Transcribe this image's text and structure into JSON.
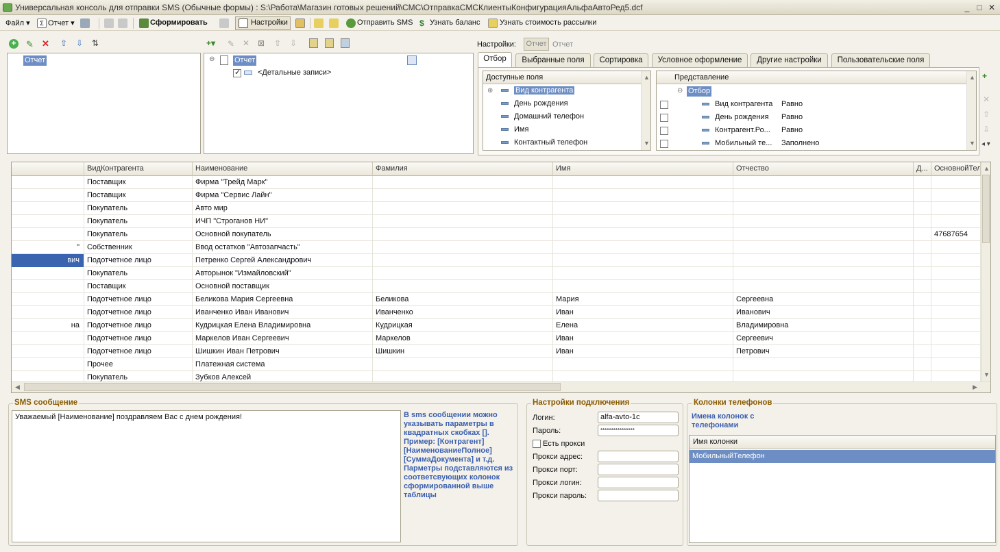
{
  "window": {
    "title": "Универсальная консоль для отправки SMS (Обычные формы) : S:\\Работа\\Магазин готовых решений\\СМС\\ОтправкаСМСКлиентыКонфигурацияАльфаАвтоРед5.dcf",
    "minimize": "_",
    "maximize": "□",
    "close": "✕"
  },
  "menu": {
    "file": "Файл ▾",
    "report": "Отчет ▾",
    "generate": "Сформировать",
    "settings": "Настройки",
    "send_sms": "Отправить SMS",
    "balance": "Узнать баланс",
    "cost": "Узнать стоимость рассылки"
  },
  "settings_label": "Настройки:",
  "settings_btn_left": "Отчет",
  "settings_btn_right": "Отчет",
  "left_tree": {
    "item": "Отчет"
  },
  "struct_tree": {
    "root": "Отчет",
    "child": "<Детальные записи>"
  },
  "tabs": [
    "Отбор",
    "Выбранные поля",
    "Сортировка",
    "Условное оформление",
    "Другие настройки",
    "Пользовательские поля"
  ],
  "available_fields": {
    "header": "Доступные поля",
    "items": [
      "Вид контрагента",
      "День рождения",
      "Домашний телефон",
      "Имя",
      "Контактный телефон"
    ]
  },
  "filter": {
    "header": "Представление",
    "root": "Отбор",
    "rows": [
      {
        "field": "Вид контрагента",
        "cond": "Равно"
      },
      {
        "field": "День рождения",
        "cond": "Равно"
      },
      {
        "field": "Контрагент.Ро...",
        "cond": "Равно"
      },
      {
        "field": "Мобильный те...",
        "cond": "Заполнено"
      }
    ]
  },
  "grid": {
    "columns": [
      "",
      "ВидКонтрагента",
      "Наименование",
      "Фамилия",
      "Имя",
      "Отчество",
      "Д...",
      "ОсновнойТел"
    ],
    "rows": [
      [
        "",
        "Поставщик",
        "Фирма \"Трейд Марк\"",
        "",
        "",
        "",
        "",
        ""
      ],
      [
        "",
        "Поставщик",
        "Фирма \"Сервис Лайн\"",
        "",
        "",
        "",
        "",
        ""
      ],
      [
        "",
        "Покупатель",
        "Авто мир",
        "",
        "",
        "",
        "",
        ""
      ],
      [
        "",
        "Покупатель",
        "ИЧП \"Строганов НИ\"",
        "",
        "",
        "",
        "",
        ""
      ],
      [
        "",
        "Покупатель",
        "Основной покупатель",
        "",
        "",
        "",
        "",
        "47687654"
      ],
      [
        "\"",
        "Собственник",
        "Ввод остатков \"Автозапчасть\"",
        "",
        "",
        "",
        "",
        ""
      ],
      [
        "вич",
        "Подотчетное лицо",
        "Петренко Сергей Александрович",
        "",
        "",
        "",
        "",
        ""
      ],
      [
        "",
        "Покупатель",
        "Авторынок \"Измайловский\"",
        "",
        "",
        "",
        "",
        ""
      ],
      [
        "",
        "Поставщик",
        "Основной поставщик",
        "",
        "",
        "",
        "",
        ""
      ],
      [
        "",
        "Подотчетное лицо",
        "Беликова Мария Сергеевна",
        "Беликова",
        "Мария",
        "Сергеевна",
        "",
        ""
      ],
      [
        "",
        "Подотчетное лицо",
        "Иванченко Иван Иванович",
        "Иванченко",
        "Иван",
        "Иванович",
        "",
        ""
      ],
      [
        "на",
        "Подотчетное лицо",
        "Кудрицкая Елена Владимировна",
        "Кудрицкая",
        "Елена",
        "Владимировна",
        "",
        ""
      ],
      [
        "",
        "Подотчетное лицо",
        "Маркелов Иван Сергеевич",
        "Маркелов",
        "Иван",
        "Сергеевич",
        "",
        ""
      ],
      [
        "",
        "Подотчетное лицо",
        "Шишкин Иван Петрович",
        "Шишкин",
        "Иван",
        "Петрович",
        "",
        ""
      ],
      [
        "",
        "Прочее",
        "Платежная система",
        "",
        "",
        "",
        "",
        ""
      ],
      [
        "",
        "Покупатель",
        "Зубков Алексей",
        "",
        "",
        "",
        "",
        ""
      ]
    ]
  },
  "sms": {
    "title": "SMS сообщение",
    "text": "Уважаемый [Наименование] поздравляем Вас с днем рождения!",
    "hint": "В sms сообщении можно указывать  параметры в квадратных скобках []. Пример: [Контрагент] [НаименованиеПолное] [СуммаДокумента] и т.д. Парметры подставляются из соответсвующих колонок сформированной выше таблицы"
  },
  "conn": {
    "title": "Настройки подключения",
    "login_label": "Логин:",
    "login": "alfa-avto-1c",
    "password_label": "Пароль:",
    "password": "****************",
    "proxy_label": "Есть прокси",
    "proxy_addr": "Прокси адрес:",
    "proxy_port": "Прокси порт:",
    "proxy_login": "Прокси логин:",
    "proxy_pass": "Прокси пароль:"
  },
  "phones": {
    "title": "Колонки телефонов",
    "subtitle": "Имена колонок с телефонами",
    "header": "Имя колонки",
    "item": "МобильныйТелефон"
  }
}
